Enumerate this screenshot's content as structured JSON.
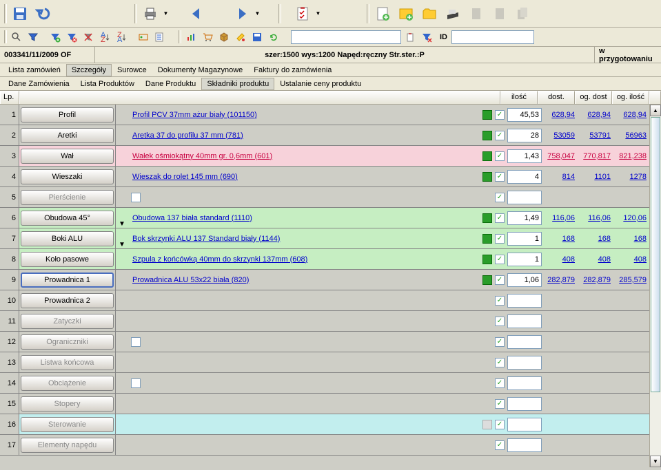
{
  "header": {
    "order_no": "003341/11/2009 OF",
    "desc": "szer:1500 wys:1200 Napęd:ręczny Str.ster.:P",
    "status": "w przygotowaniu"
  },
  "tabs_main": [
    "Lista zamówień",
    "Szczegóły",
    "Surowce",
    "Dokumenty Magazynowe",
    "Faktury do zamówienia"
  ],
  "tabs_main_active": 1,
  "tabs_sub": [
    "Dane Zamówienia",
    "Lista Produktów",
    "Dane Produktu",
    "Składniki produktu",
    "Ustalanie ceny produktu"
  ],
  "tabs_sub_active": 3,
  "id_label": "ID",
  "grid_headers": {
    "lp": "Lp.",
    "ilosc": "ilość",
    "dost": "dost.",
    "og_dost": "og. dost",
    "og_ilosc": "og. ilość"
  },
  "rows": [
    {
      "lp": 1,
      "btn": "Profil",
      "dim": false,
      "dd": false,
      "link": "Profil  PCV 37mm ażur biały  (101150)",
      "green": true,
      "cb": true,
      "ilosc": "45,53",
      "dost": "628,94",
      "og_dost": "628,94",
      "og_ilosc": "628,94",
      "cls": ""
    },
    {
      "lp": 2,
      "btn": "Aretki",
      "dim": false,
      "dd": false,
      "link": "Aretka 37 do profilu 37 mm (781)",
      "green": true,
      "cb": true,
      "ilosc": "28",
      "dost": "53059",
      "og_dost": "53791",
      "og_ilosc": "56963",
      "cls": ""
    },
    {
      "lp": 3,
      "btn": "Wał",
      "dim": false,
      "dd": false,
      "link": "Wałek ośmiokątny 40mm gr. 0,6mm (601)",
      "green": true,
      "cb": true,
      "ilosc": "1,43",
      "dost": "758,047",
      "og_dost": "770,817",
      "og_ilosc": "821,238",
      "cls": "pink"
    },
    {
      "lp": 4,
      "btn": "Wieszaki",
      "dim": false,
      "dd": false,
      "link": "Wieszak do rolet 145 mm (690)",
      "green": true,
      "cb": true,
      "ilosc": "4",
      "dost": "814",
      "og_dost": "1101",
      "og_ilosc": "1278",
      "cls": ""
    },
    {
      "lp": 5,
      "btn": "Pierścienie",
      "dim": true,
      "dd": false,
      "midcb": true,
      "link": "",
      "green": false,
      "cb": true,
      "ilosc": "",
      "dost": "",
      "og_dost": "",
      "og_ilosc": "",
      "cls": ""
    },
    {
      "lp": 6,
      "btn": "Obudowa 45°",
      "dim": false,
      "dd": true,
      "link": "Obudowa 137 biała standard (1110)",
      "green": true,
      "cb": true,
      "ilosc": "1,49",
      "dost": "116,06",
      "og_dost": "116,06",
      "og_ilosc": "120,06",
      "cls": "green"
    },
    {
      "lp": 7,
      "btn": "Boki ALU",
      "dim": false,
      "dd": true,
      "link": "Bok skrzynki ALU 137 Standard biały (1144)",
      "green": true,
      "cb": true,
      "ilosc": "1",
      "dost": "168",
      "og_dost": "168",
      "og_ilosc": "168",
      "cls": "green"
    },
    {
      "lp": 8,
      "btn": "Koło pasowe",
      "dim": false,
      "dd": false,
      "link": "Szpula z końcówką 40mm do skrzynki 137mm (608)",
      "green": true,
      "cb": true,
      "ilosc": "1",
      "dost": "408",
      "og_dost": "408",
      "og_ilosc": "408",
      "cls": "green"
    },
    {
      "lp": 9,
      "btn": "Prowadnica 1",
      "dim": false,
      "sel": true,
      "dd": false,
      "link": "Prowadnica ALU 53x22 biała (820)",
      "green": true,
      "cb": true,
      "ilosc": "1,06",
      "dost": "282,879",
      "og_dost": "282,879",
      "og_ilosc": "285,579",
      "cls": ""
    },
    {
      "lp": 10,
      "btn": "Prowadnica 2",
      "dim": false,
      "dd": false,
      "link": "",
      "green": false,
      "cb": true,
      "ilosc": "",
      "dost": "",
      "og_dost": "",
      "og_ilosc": "",
      "cls": ""
    },
    {
      "lp": 11,
      "btn": "Zatyczki",
      "dim": true,
      "dd": false,
      "link": "",
      "green": false,
      "cb": true,
      "ilosc": "",
      "dost": "",
      "og_dost": "",
      "og_ilosc": "",
      "cls": ""
    },
    {
      "lp": 12,
      "btn": "Ograniczniki",
      "dim": true,
      "dd": false,
      "midcb": true,
      "link": "",
      "green": false,
      "cb": true,
      "ilosc": "",
      "dost": "",
      "og_dost": "",
      "og_ilosc": "",
      "cls": ""
    },
    {
      "lp": 13,
      "btn": "Listwa końcowa",
      "dim": true,
      "dd": false,
      "link": "",
      "green": false,
      "cb": true,
      "ilosc": "",
      "dost": "",
      "og_dost": "",
      "og_ilosc": "",
      "cls": ""
    },
    {
      "lp": 14,
      "btn": "Obciążenie",
      "dim": true,
      "dd": false,
      "midcb": true,
      "link": "",
      "green": false,
      "cb": true,
      "ilosc": "",
      "dost": "",
      "og_dost": "",
      "og_ilosc": "",
      "cls": ""
    },
    {
      "lp": 15,
      "btn": "Stopery",
      "dim": true,
      "dd": false,
      "link": "",
      "green": false,
      "cb": true,
      "ilosc": "",
      "dost": "",
      "og_dost": "",
      "og_ilosc": "",
      "cls": ""
    },
    {
      "lp": 16,
      "btn": "Sterowanie",
      "dim": true,
      "dd": false,
      "link": "",
      "green": false,
      "cb": true,
      "ilosc": "",
      "dost": "",
      "og_dost": "",
      "og_ilosc": "",
      "cls": "cyan"
    },
    {
      "lp": 17,
      "btn": "Elementy napędu",
      "dim": true,
      "dd": false,
      "link": "",
      "green": false,
      "cb": true,
      "ilosc": "",
      "dost": "",
      "og_dost": "",
      "og_ilosc": "",
      "cls": ""
    }
  ]
}
